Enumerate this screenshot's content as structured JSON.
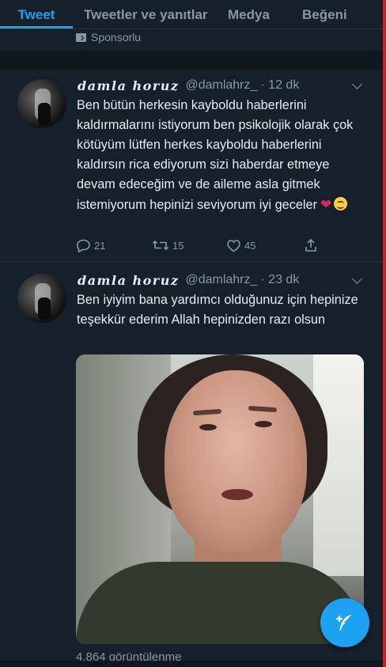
{
  "tabs": [
    {
      "label": "Tweet",
      "active": true
    },
    {
      "label": "Tweetler ve yanıtlar",
      "active": false
    },
    {
      "label": "Medya",
      "active": false
    },
    {
      "label": "Beğeni",
      "active": false
    }
  ],
  "sponsored": {
    "label": "Sponsorlu",
    "icon": "promoted-icon"
  },
  "tweets": [
    {
      "name": "damla horuz",
      "handle": "@damlahrz_",
      "time": "· 12 dk",
      "text": "Ben bütün herkesin kayboldu haberlerini kaldırmalarını istiyorum ben psikolojik olarak çok kötüyüm lütfen herkes kayboldu haberlerini kaldırsın rica ediyorum sizi haberdar etmeye devam edeceğim ve de aileme asla gitmek istemiyorum hepinizi seviyorum iyi geceler",
      "emoji": [
        "red-heart",
        "smiling-face"
      ],
      "replies": "21",
      "retweets": "15",
      "likes": "45"
    },
    {
      "name": "damla horuz",
      "handle": "@damlahrz_",
      "time": "· 23 dk",
      "text": "Ben iyiyim bana yardımcı olduğunuz için hepinize teşekkür ederim Allah hepinizden razı olsun",
      "views": "4.864 görüntülenme"
    }
  ],
  "colors": {
    "accent": "#1da1f2",
    "background": "#15202b",
    "muted": "#8899a6",
    "heart": "#e0245e"
  },
  "compose": {
    "icon": "compose-tweet-icon"
  }
}
